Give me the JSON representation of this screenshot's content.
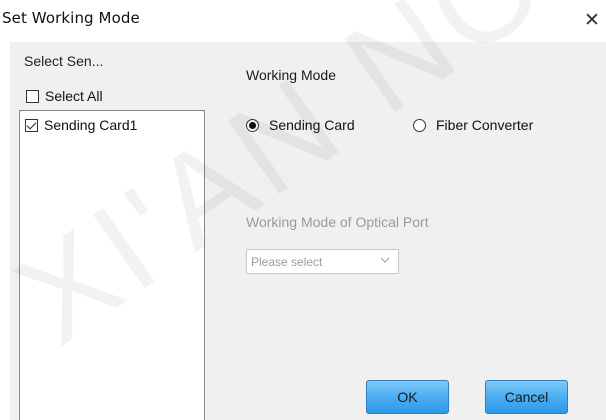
{
  "window": {
    "title": "Set Working Mode",
    "close_symbol": "✕"
  },
  "left_panel": {
    "label": "Select Sen...",
    "select_all_label": "Select All",
    "select_all_checked": false,
    "items": [
      {
        "label": "Sending Card1",
        "checked": true
      }
    ]
  },
  "working_mode": {
    "label": "Working Mode",
    "options": [
      {
        "label": "Sending Card",
        "selected": true
      },
      {
        "label": "Fiber Converter",
        "selected": false
      }
    ]
  },
  "optical_port": {
    "label": "Working Mode of Optical Port",
    "select_value": "Please select",
    "enabled": false
  },
  "buttons": {
    "ok_label": "OK",
    "cancel_label": "Cancel"
  },
  "watermark": {
    "text": "XI'AN NOVA"
  },
  "colors": {
    "button_gradient_top": "#7fc9f8",
    "button_gradient_bottom": "#2e98e9",
    "button_border": "#2f7fc4",
    "dialog_background": "#f0f0f0",
    "disabled_text": "#9a9a9a"
  },
  "icons": {
    "close": "close-icon",
    "dropdown": "chevron-down-icon"
  }
}
